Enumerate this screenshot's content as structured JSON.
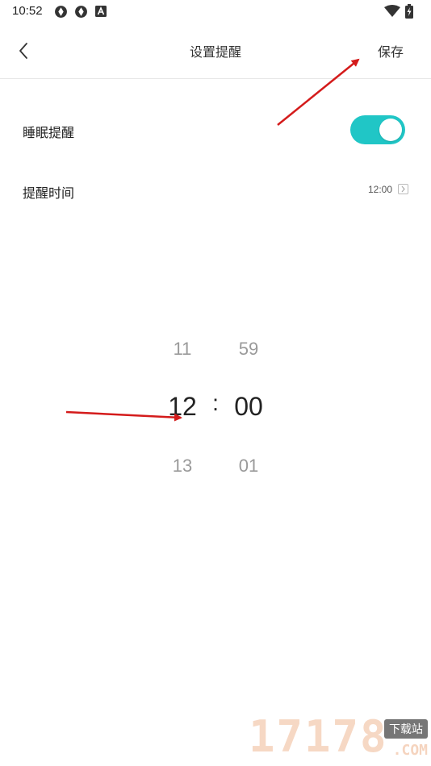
{
  "status_bar": {
    "time": "10:52",
    "icons": [
      "sync-icon",
      "sync-icon",
      "a-badge-icon",
      "wifi-icon",
      "battery-charging-icon"
    ]
  },
  "header": {
    "back_icon": "chevron-left-icon",
    "title": "设置提醒",
    "save_label": "保存"
  },
  "settings": {
    "sleep_reminder": {
      "label": "睡眠提醒",
      "enabled": true,
      "toggle_color": "#20c6c6"
    },
    "reminder_time": {
      "label": "提醒时间",
      "value": "12:00"
    }
  },
  "time_picker": {
    "hours": {
      "prev": "11",
      "selected": "12",
      "next": "13"
    },
    "minutes": {
      "prev": "59",
      "selected": "00",
      "next": "01"
    },
    "separator": ":"
  },
  "watermark": {
    "digits": "17178",
    "tag": "下载站",
    "domain": ".COM"
  },
  "colors": {
    "accent": "#20c6c6",
    "annotation_arrow": "#d41b1b"
  }
}
